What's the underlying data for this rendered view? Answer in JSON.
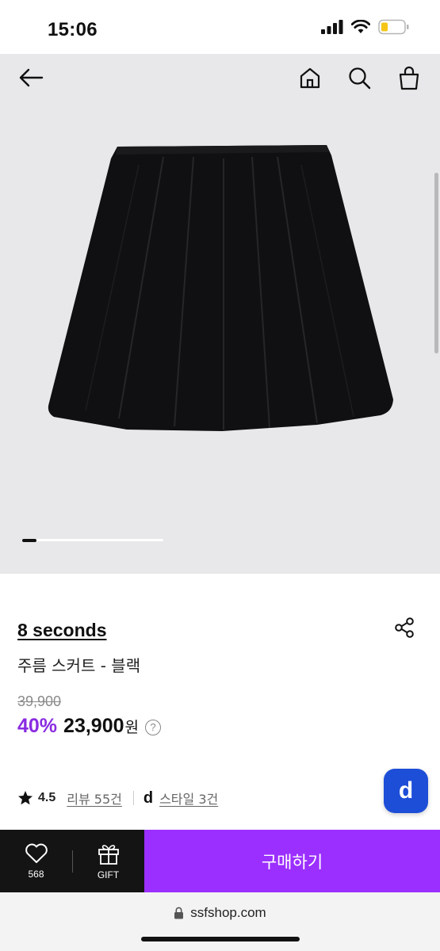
{
  "status": {
    "time": "15:06"
  },
  "nav": {
    "back": "back-arrow",
    "home": "home",
    "search": "search",
    "cart": "shopping-bag"
  },
  "gallery": {
    "current_slide": 1,
    "slide_fraction": 0.1
  },
  "product": {
    "brand": "8 seconds",
    "name": "주름 스커트 - 블랙",
    "original_price": "39,900",
    "discount": "40%",
    "price": "23,900",
    "currency": "원",
    "help": "?"
  },
  "meta": {
    "rating": "4.5",
    "reviews": "리뷰 55건",
    "styles": "스타일 3건",
    "d_mark": "d"
  },
  "fab": {
    "label": "d"
  },
  "bottom": {
    "wish_count": "568",
    "gift_label": "GIFT",
    "buy_label": "구매하기"
  },
  "browser": {
    "url": "ssfshop.com"
  },
  "colors": {
    "accent": "#9b2fff",
    "discount": "#8a2be2",
    "fab": "#1d4ed8",
    "bar_dark": "#141414"
  }
}
